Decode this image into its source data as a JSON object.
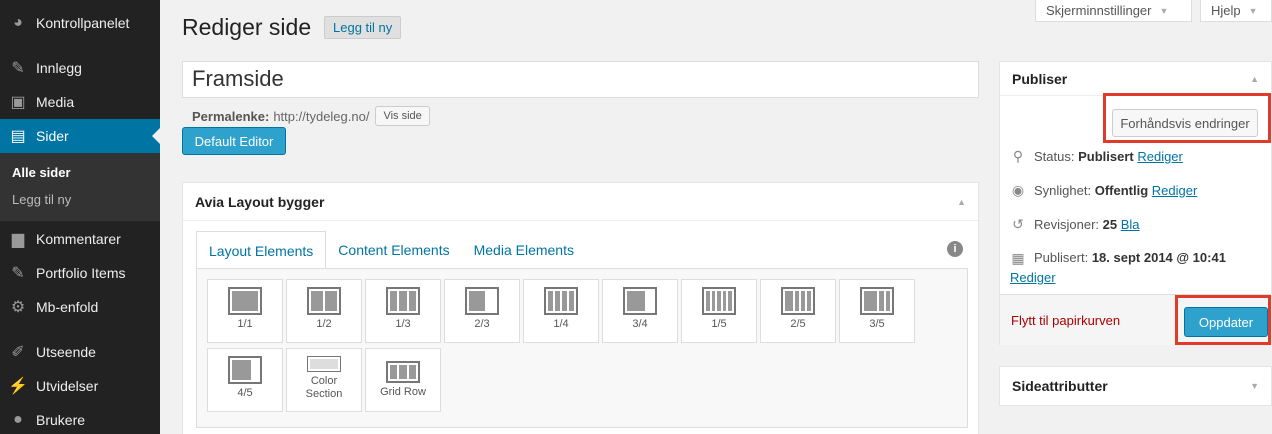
{
  "sidebar": {
    "items": [
      {
        "label": "Kontrollpanelet",
        "icon": "dashboard-icon"
      },
      {
        "label": "Innlegg",
        "icon": "pin-icon"
      },
      {
        "label": "Media",
        "icon": "media-icon"
      },
      {
        "label": "Sider",
        "icon": "pages-icon"
      },
      {
        "label": "Kommentarer",
        "icon": "comment-icon"
      },
      {
        "label": "Portfolio Items",
        "icon": "pin-icon"
      },
      {
        "label": "Mb-enfold",
        "icon": "gear-icon"
      },
      {
        "label": "Utseende",
        "icon": "brush-icon"
      },
      {
        "label": "Utvidelser",
        "icon": "plugin-icon"
      },
      {
        "label": "Brukere",
        "icon": "user-icon"
      }
    ],
    "submenu": [
      "Alle sider",
      "Legg til ny"
    ]
  },
  "top": {
    "screen_options": "Skjerminnstillinger",
    "help": "Hjelp"
  },
  "header": {
    "title": "Rediger side",
    "add_new": "Legg til ny"
  },
  "post": {
    "title_value": "Framside",
    "permalink_label": "Permalenke:",
    "permalink_url": "http://tydeleg.no/",
    "view_button": "Vis side",
    "default_editor": "Default Editor"
  },
  "avia": {
    "title": "Avia Layout bygger",
    "tabs": [
      "Layout Elements",
      "Content Elements",
      "Media Elements"
    ],
    "elements": [
      "1/1",
      "1/2",
      "1/3",
      "2/3",
      "1/4",
      "3/4",
      "1/5",
      "2/5",
      "3/5",
      "4/5",
      "Color Section",
      "Grid Row"
    ]
  },
  "publish": {
    "title": "Publiser",
    "preview": "Forhåndsvis endringer",
    "status_label": "Status:",
    "status_value": "Publisert",
    "visibility_label": "Synlighet:",
    "visibility_value": "Offentlig",
    "revisions_label": "Revisjoner:",
    "revisions_value": "25",
    "revisions_link": "Bla",
    "published_label": "Publisert:",
    "published_value": "18. sept 2014 @ 10:41",
    "edit_link": "Rediger",
    "trash": "Flytt til papirkurven",
    "update": "Oppdater"
  },
  "attributes": {
    "title": "Sideattributter"
  },
  "colors": {
    "accent": "#0074a2",
    "button": "#2ea2cc",
    "highlight": "#e03a2b",
    "sidebar": "#222222"
  }
}
